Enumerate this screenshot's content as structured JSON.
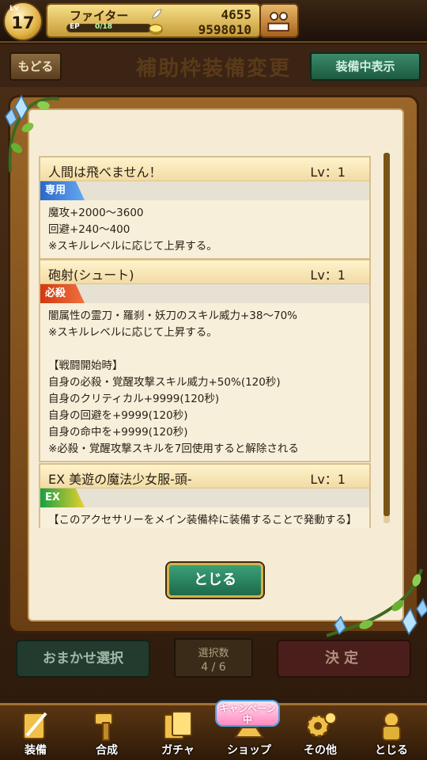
{
  "status_bar": {
    "level_tag": "Lv",
    "level": "17",
    "player_name": "ファイター",
    "ep_label": "EP",
    "ep_value": "0/18",
    "ep_fraction": 0.0,
    "stones": "4655",
    "gold": "9598010"
  },
  "header": {
    "back_label": "もどる",
    "title": "補助枠装備変更",
    "show_equipped_label": "装備中表示"
  },
  "modal": {
    "scroll_fraction": 0.98,
    "skills": [
      {
        "title": "人間は飛べません！",
        "level": "Lv：1",
        "tag": "専用",
        "tag_color": "#2a68c8",
        "lines": [
          "魔攻+2000～3600",
          "回避+240～400",
          "※スキルレベルに応じて上昇する。"
        ]
      },
      {
        "title": "砲射(シュート)",
        "level": "Lv：1",
        "tag": "必殺",
        "tag_color": "#d03a10",
        "lines": [
          "闇属性の霊刀・羅刹・妖刀のスキル威力+38～70%",
          "※スキルレベルに応じて上昇する。",
          "",
          "【戦闘開始時】",
          "自身の必殺・覚醒攻撃スキル威力+50%(120秒)",
          "自身のクリティカル+9999(120秒)",
          "自身の回避を+9999(120秒)",
          "自身の命中を+9999(120秒)",
          "※必殺・覚醒攻撃スキルを7回使用すると解除される"
        ]
      },
      {
        "title": "EX 美遊の魔法少女服-頭-",
        "level": "Lv：1",
        "tag": "EX",
        "tag_color": "#18a040",
        "lines": [
          "【このアクセサリーをメイン装備枠に装備することで発動する】"
        ]
      }
    ],
    "close_label": "とじる"
  },
  "bottom_controls": {
    "auto_select_label": "おまかせ選択",
    "selection_count_label": "選択数",
    "selection_count_value": "4 / 6",
    "decide_label": "決定"
  },
  "bottom_nav": {
    "campaign_badge": "キャンペーン中",
    "items": [
      {
        "label": "装備",
        "icon": "sword-icon"
      },
      {
        "label": "合成",
        "icon": "hammer-icon"
      },
      {
        "label": "ガチャ",
        "icon": "gacha-card-icon"
      },
      {
        "label": "ショップ",
        "icon": "gold-bars-icon"
      },
      {
        "label": "その他",
        "icon": "gears-icon"
      },
      {
        "label": "とじる",
        "icon": "golden-idol-icon"
      }
    ]
  },
  "colors": {
    "modal_bg": "#f6ecd6",
    "frame": "#9a6628",
    "accent_green": "#1c6a4a",
    "gold": "#d6b24a"
  }
}
